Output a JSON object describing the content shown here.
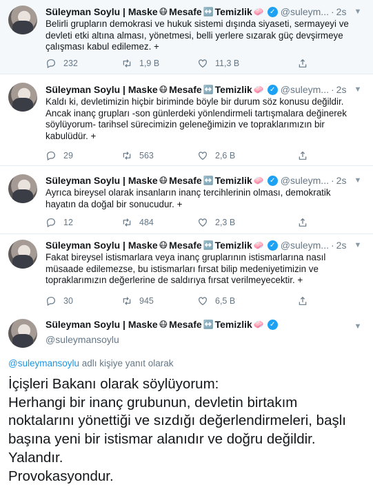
{
  "tweets": [
    {
      "author": "Süleyman Soylu | Maske",
      "mask_emoji": "😷",
      "mesafe": "Mesafe",
      "arrows_emoji": "↔️",
      "temizlik": "Temizlik",
      "soap_emoji": "🧼",
      "handle": "@suleym...",
      "time": "2s",
      "text": "Belirli grupların demokrasi ve hukuk sistemi dışında siyaseti, sermayeyi ve devleti etki altına alması, yönetmesi, belli yerlere sızarak güç devşirmeye çalışması kabul edilemez. +",
      "replies": "232",
      "retweets": "1,9 B",
      "likes": "11,3 B"
    },
    {
      "author": "Süleyman Soylu | Maske",
      "mask_emoji": "😷",
      "mesafe": "Mesafe",
      "arrows_emoji": "↔️",
      "temizlik": "Temizlik",
      "soap_emoji": "🧼",
      "handle": "@suleym...",
      "time": "2s",
      "text": "Kaldı ki, devletimizin hiçbir biriminde böyle bir durum söz konusu değildir. Ancak inanç grupları -son günlerdeki yönlendirmeli tartışmalara değinerek söylüyorum- tarihsel sürecimizin geleneğimizin ve topraklarımızın bir kabulüdür. +",
      "replies": "29",
      "retweets": "563",
      "likes": "2,6 B"
    },
    {
      "author": "Süleyman Soylu | Maske",
      "mask_emoji": "😷",
      "mesafe": "Mesafe",
      "arrows_emoji": "↔️",
      "temizlik": "Temizlik",
      "soap_emoji": "🧼",
      "handle": "@suleym...",
      "time": "2s",
      "text": "Ayrıca bireysel olarak insanların inanç tercihlerinin olması, demokratik hayatın da doğal bir sonucudur. +",
      "replies": "12",
      "retweets": "484",
      "likes": "2,3 B"
    },
    {
      "author": "Süleyman Soylu | Maske",
      "mask_emoji": "😷",
      "mesafe": "Mesafe",
      "arrows_emoji": "↔️",
      "temizlik": "Temizlik",
      "soap_emoji": "🧼",
      "handle": "@suleym...",
      "time": "2s",
      "text": "Fakat bireysel istismarlara veya inanç gruplarının istismarlarına nasıl müsaade edilemezse, bu istismarları fırsat bilip medeniyetimizin ve topraklarımızın değerlerine de saldırıya fırsat verilmeyecektir. +",
      "replies": "30",
      "retweets": "945",
      "likes": "6,5 B"
    }
  ],
  "main": {
    "author": "Süleyman Soylu | Maske",
    "mask_emoji": "😷",
    "mesafe": "Mesafe",
    "arrows_emoji": "↔️",
    "temizlik": "Temizlik",
    "soap_emoji": "🧼",
    "handle": "@suleymansoylu",
    "reply_user": "@suleymansoylu",
    "reply_suffix": " adlı kişiye yanıt olarak",
    "lines": [
      "İçişleri Bakanı olarak söylüyorum:",
      "Herhangi bir inanç grubunun, devletin birtakım",
      "noktalarını yönettiği ve sızdığı değerlendirmeleri, başlı",
      "başına yeni bir istismar alanıdır ve doğru değildir.",
      "Yalandır.",
      "Provokasyondur."
    ]
  },
  "icons": {
    "reply": "reply-icon",
    "retweet": "retweet-icon",
    "like": "like-icon",
    "share": "share-icon",
    "caret": "chevron-down-icon",
    "verified": "verified-badge-icon"
  },
  "colors": {
    "accent": "#1da1f2",
    "link": "#1b95e0",
    "muted": "#657786",
    "text": "#14171a",
    "highlight_bg": "#f5f8fa"
  }
}
